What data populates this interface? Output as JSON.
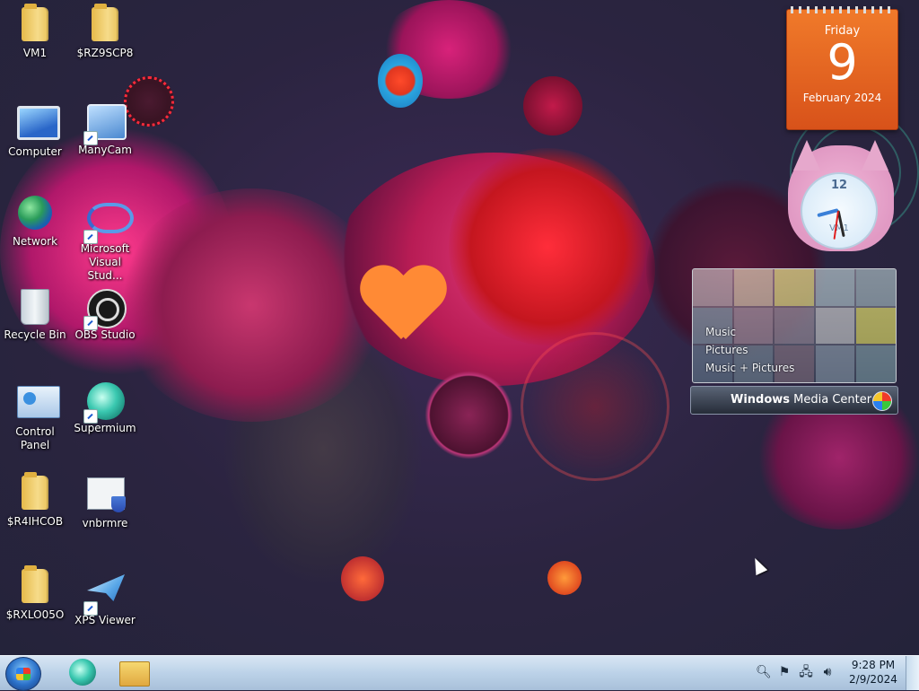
{
  "desktop": {
    "icons": [
      {
        "label": "VM1",
        "icon": "user-folder-icon"
      },
      {
        "label": "$RZ9SCP8",
        "icon": "folder-icon"
      },
      {
        "label": "Computer",
        "icon": "computer-icon"
      },
      {
        "label": "ManyCam",
        "icon": "manycam-icon"
      },
      {
        "label": "Network",
        "icon": "network-icon"
      },
      {
        "label": "Microsoft Visual Stud...",
        "icon": "visual-studio-icon"
      },
      {
        "label": "Recycle Bin",
        "icon": "recycle-bin-icon"
      },
      {
        "label": "OBS Studio",
        "icon": "obs-icon"
      },
      {
        "label": "Control Panel",
        "icon": "control-panel-icon"
      },
      {
        "label": "Supermium",
        "icon": "supermium-icon"
      },
      {
        "label": "$R4IHCOB",
        "icon": "folder-icon"
      },
      {
        "label": "vnbrmre",
        "icon": "shield-document-icon"
      },
      {
        "label": "$RXLO05O",
        "icon": "folder-icon"
      },
      {
        "label": "XPS Viewer",
        "icon": "xps-viewer-icon"
      }
    ]
  },
  "calendar_gadget": {
    "weekday": "Friday",
    "day": "9",
    "month_year": "February 2024",
    "color": "#e8632a"
  },
  "clock_gadget": {
    "number_12": "12",
    "label": "VM1"
  },
  "media_center_gadget": {
    "menu": [
      "Music",
      "Pictures",
      "Music + Pictures"
    ],
    "title_bold": "Windows",
    "title_rest": " Media Center"
  },
  "taskbar": {
    "pinned": [
      "supermium-icon",
      "windows-explorer-icon"
    ],
    "tray_icons": [
      "search-icon",
      "action-center-flag-icon",
      "network-icon",
      "volume-icon"
    ],
    "time": "9:28 PM",
    "date": "2/9/2024"
  }
}
